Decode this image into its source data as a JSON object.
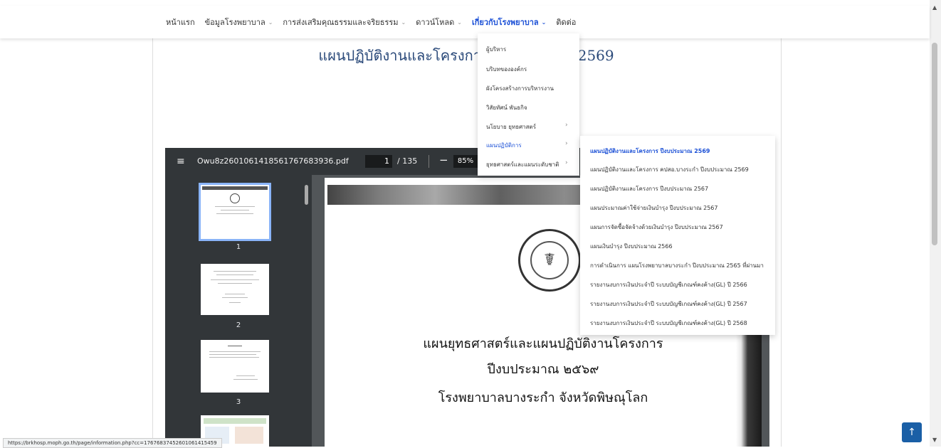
{
  "nav": {
    "items": [
      {
        "label": "หน้าแรก",
        "dropdown": false
      },
      {
        "label": "ข้อมูลโรงพยาบาล",
        "dropdown": true
      },
      {
        "label": "การส่งเสริมคุณธรรมและจริยธรรม",
        "dropdown": true
      },
      {
        "label": "ดาวน์โหลด",
        "dropdown": true
      },
      {
        "label": "เกี่ยวกับโรงพยาบาล",
        "dropdown": true,
        "active": true
      },
      {
        "label": "ติดต่อ",
        "dropdown": false
      }
    ],
    "chevron": "⌄"
  },
  "page_title": "แผนปฏิบัติงานและโครงการ ปีงบประมาณ 2569",
  "dropdown": {
    "items": [
      {
        "label": "ผู้บริหาร"
      },
      {
        "label": "บริบทขององค์กร"
      },
      {
        "label": "ผังโครงสร้างการบริหารงาน"
      },
      {
        "label": "วิสัยทัศน์ พันธกิจ"
      },
      {
        "label": "นโยบาย ยุทธศาสตร์",
        "arrow": "›"
      },
      {
        "label": "แผนปฏิบัติการ",
        "arrow": "›",
        "active": true
      },
      {
        "label": "ยุทธศาสตร์และแผนระดับชาติ",
        "arrow": "›"
      }
    ]
  },
  "submenu": {
    "items": [
      {
        "label": "แผนปฏิบัติงานและโครงการ ปีงบประมาณ 2569",
        "active": true
      },
      {
        "label": "แผนปฏิบัติงานและโครงการ คปสอ.บางระกำ ปีงบประมาณ 2569"
      },
      {
        "label": "แผนปฏิบัติงานและโครงการ ปีงบประมาณ 2567"
      },
      {
        "label": "แผนประมาณค่าใช้จ่ายเงินบำรุง ปีงบประมาณ 2567"
      },
      {
        "label": "แผนการจัดซื้อจัดจ้างด้วยเงินบำรุง ปีงบประมาณ 2567"
      },
      {
        "label": "แผนเงินบำรุง ปีงบประมาณ 2566"
      },
      {
        "label": "การดำเนินการ แผนโรงพยาบาลบางระกำ ปีงบประมาณ 2565 ที่ผ่านมา"
      },
      {
        "label": "รายงานงบการเงินประจำปี ระบบบัญชีเกณฑ์คงค้าง(GL) ปี 2566"
      },
      {
        "label": "รายงานงบการเงินประจำปี ระบบบัญชีเกณฑ์คงค้าง(GL) ปี 2567"
      },
      {
        "label": "รายงานงบการเงินประจำปี ระบบบัญชีเกณฑ์คงค้าง(GL) ปี 2568"
      }
    ]
  },
  "pdf": {
    "menu_icon": "≡",
    "filename": "Owu8z2601061418561767683936.pdf",
    "current_page": "1",
    "total_pages": "/ 135",
    "minus": "−",
    "zoom": "85%",
    "plus": "+",
    "thumbnails": [
      "1",
      "2",
      "3"
    ],
    "seal_text": "Bangrakam Hospital · Ministry of Public Health",
    "seal_symbol": "☤",
    "doc_lines": [
      "แผนยุทธศาสตร์และแผนปฏิบัติงานโครงการ",
      "ปีงบประมาณ ๒๕๖๙",
      "โรงพยาบาลบางระกำ จังหวัดพิษณุโลก"
    ]
  },
  "status_url": "https://brkhosp.moph.go.th/page/information.php?cc=17676837452601061415459",
  "to_top": "↑",
  "scroll": {
    "up": "▲",
    "down": "▼"
  }
}
